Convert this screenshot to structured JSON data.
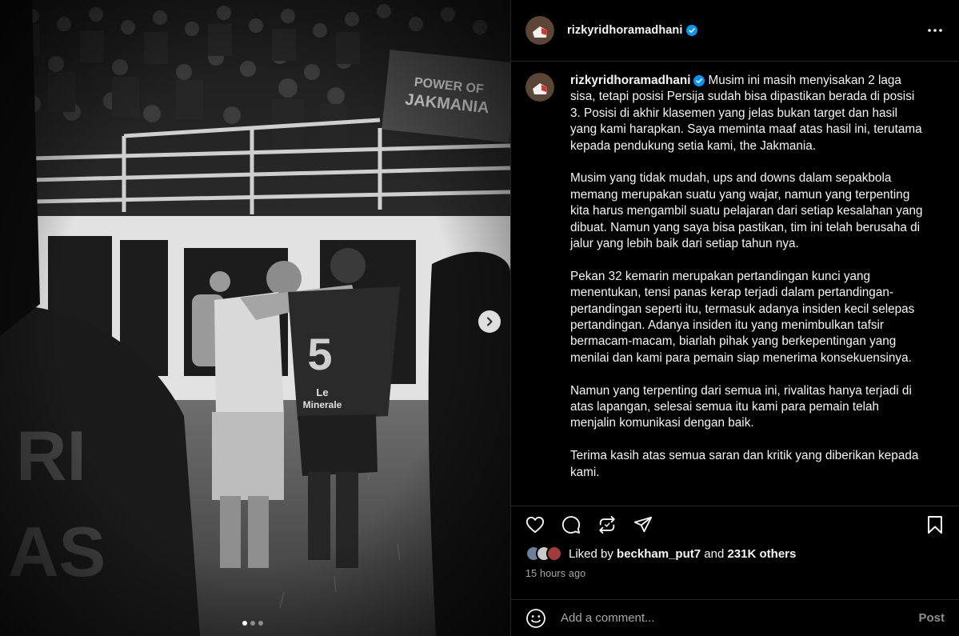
{
  "post": {
    "username": "rizkyridhoramadhani",
    "verified_icon": "verified-badge-icon",
    "more_icon": "more-options-icon",
    "caption": {
      "username": "rizkyridhoramadhani",
      "paragraphs": [
        "Musim ini masih menyisakan 2 laga sisa, tetapi posisi Persija sudah bisa dipastikan berada di posisi 3. Posisi di akhir klasemen yang jelas bukan target dan hasil yang kami harapkan. Saya meminta maaf atas hasil ini, terutama kepada pendukung setia kami, the Jakmania.",
        "Musim yang tidak mudah, ups and downs dalam sepakbola memang merupakan suatu yang wajar, namun yang terpenting kita harus mengambil suatu pelajaran dari setiap kesalahan yang dibuat. Namun yang saya bisa pastikan, tim ini telah berusaha di jalur yang lebih baik dari setiap tahun nya.",
        "Pekan 32 kemarin merupakan pertandingan kunci yang menentukan, tensi panas kerap terjadi dalam pertandingan-pertandingan seperti itu, termasuk adanya insiden kecil selepas pertandingan. Adanya insiden itu yang menimbulkan tafsir bermacam-macam, biarlah pihak yang berkepentingan yang menilai dan kami para pemain siap menerima konsekuensinya.",
        "Namun yang terpenting dari semua ini, rivalitas hanya terjadi di atas lapangan, selesai semua itu kami para pemain telah menjalin komunikasi dengan baik.",
        "Terima kasih atas semua saran dan kritik yang diberikan kepada kami."
      ]
    },
    "likes": {
      "prefix": "Liked by",
      "user": "beckham_put7",
      "and": "and",
      "others": "231K others"
    },
    "time_ago": "15 hours ago",
    "comment": {
      "placeholder": "Add a comment...",
      "post_label": "Post"
    },
    "media": {
      "banner_text": "POWER OF JAKMANIA",
      "jersey_number": "5",
      "sponsor_text": "Le Minerale",
      "carousel_total": 3,
      "carousel_active": 1
    }
  }
}
